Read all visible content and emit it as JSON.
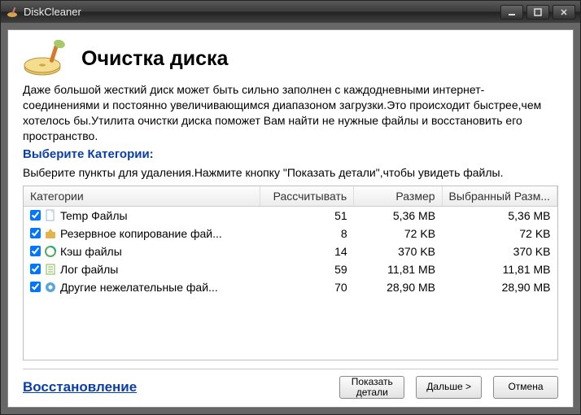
{
  "titlebar": {
    "title": "DiskCleaner"
  },
  "main": {
    "heading": "Очистка диска",
    "description": "Даже большой жесткий диск может быть сильно заполнен с каждодневными интернет-соединениями и постоянно увеличивающимся диапазоном загрузки.Это происходит быстреe,чем хотелось бы.Утилита очистки диска поможет Вам найти не нужные файлы и восстановить его пространство.",
    "subheading": "Выберите Категории:",
    "instruction": "Выберите пункты для удаления.Нажмите кнопку \"Показать детали\",чтобы увидеть файлы."
  },
  "table": {
    "headers": {
      "category": "Категории",
      "count": "Рассчитывать",
      "size": "Размер",
      "selected_size": "Выбранный Разм..."
    },
    "rows": [
      {
        "icon": "page-icon",
        "name": "Temp Файлы",
        "count": "51",
        "size": "5,36 MB",
        "selected": "5,36 MB"
      },
      {
        "icon": "backup-icon",
        "name": "Резервное копирование фай...",
        "count": "8",
        "size": "72 KB",
        "selected": "72 KB"
      },
      {
        "icon": "cache-icon",
        "name": "Кэш файлы",
        "count": "14",
        "size": "370 KB",
        "selected": "370 KB"
      },
      {
        "icon": "log-icon",
        "name": "Лог файлы",
        "count": "59",
        "size": "11,81 MB",
        "selected": "11,81 MB"
      },
      {
        "icon": "junk-icon",
        "name": "Другие нежелательные фай...",
        "count": "70",
        "size": "28,90 MB",
        "selected": "28,90 MB"
      }
    ]
  },
  "footer": {
    "recovery": "Восстановление",
    "details": "Показать\nдетали",
    "next": "Дальше >",
    "cancel": "Отмена"
  },
  "icons": {
    "page-icon": "#6fa8dc",
    "backup-icon": "#e6b24a",
    "cache-icon": "#5fa85f",
    "log-icon": "#7fb84f",
    "junk-icon": "#5aa6d8"
  }
}
